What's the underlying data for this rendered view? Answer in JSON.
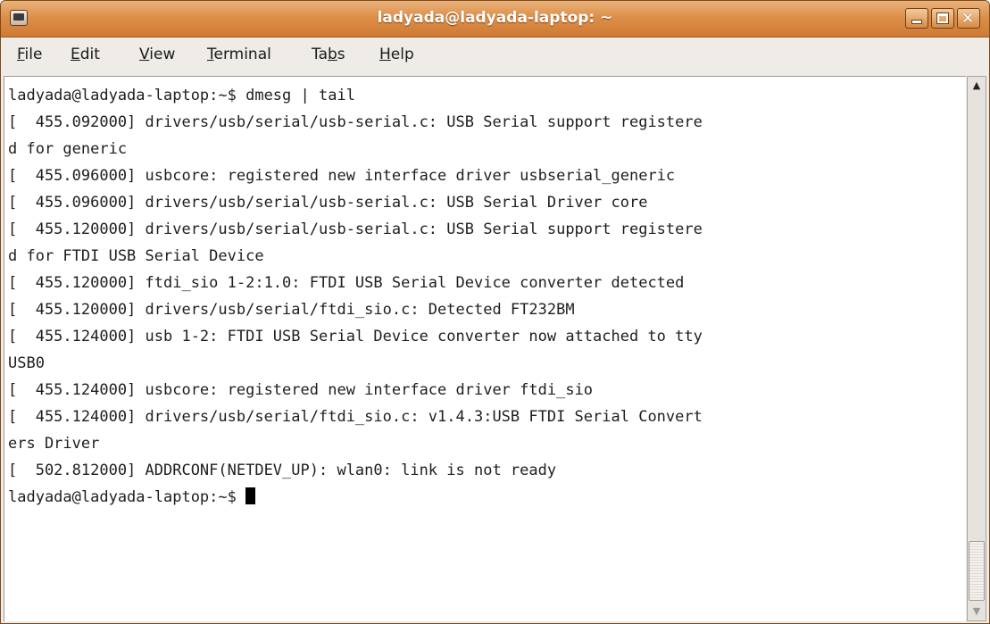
{
  "window": {
    "title": "ladyada@ladyada-laptop: ~"
  },
  "menubar": {
    "items": [
      {
        "mnemonic": "F",
        "rest": "ile"
      },
      {
        "mnemonic": "E",
        "rest": "dit"
      },
      {
        "mnemonic": "V",
        "rest": "iew"
      },
      {
        "mnemonic": "T",
        "rest": "erminal"
      },
      {
        "pre": "Ta",
        "mnemonic": "b",
        "rest": "s"
      },
      {
        "mnemonic": "H",
        "rest": "elp"
      }
    ]
  },
  "terminal": {
    "lines": [
      "ladyada@ladyada-laptop:~$ dmesg | tail",
      "[  455.092000] drivers/usb/serial/usb-serial.c: USB Serial support registere",
      "d for generic",
      "[  455.096000] usbcore: registered new interface driver usbserial_generic",
      "[  455.096000] drivers/usb/serial/usb-serial.c: USB Serial Driver core",
      "[  455.120000] drivers/usb/serial/usb-serial.c: USB Serial support registere",
      "d for FTDI USB Serial Device",
      "[  455.120000] ftdi_sio 1-2:1.0: FTDI USB Serial Device converter detected",
      "[  455.120000] drivers/usb/serial/ftdi_sio.c: Detected FT232BM",
      "[  455.124000] usb 1-2: FTDI USB Serial Device converter now attached to tty",
      "USB0",
      "[  455.124000] usbcore: registered new interface driver ftdi_sio",
      "[  455.124000] drivers/usb/serial/ftdi_sio.c: v1.4.3:USB FTDI Serial Convert",
      "ers Driver",
      "[  502.812000] ADDRCONF(NETDEV_UP): wlan0: link is not ready"
    ],
    "prompt": "ladyada@ladyada-laptop:~$ "
  },
  "icons": {
    "window_menu": "window-menu-icon",
    "minimize": "minimize-icon",
    "maximize": "maximize-icon",
    "close": "close-icon",
    "scroll_up": "scroll-up-arrow-icon",
    "scroll_down": "scroll-down-arrow-icon"
  },
  "colors": {
    "titlebar": "#dc8f4a",
    "menubar": "#efebe7",
    "terminal_bg": "#ffffff",
    "terminal_fg": "#1e1e1e"
  }
}
